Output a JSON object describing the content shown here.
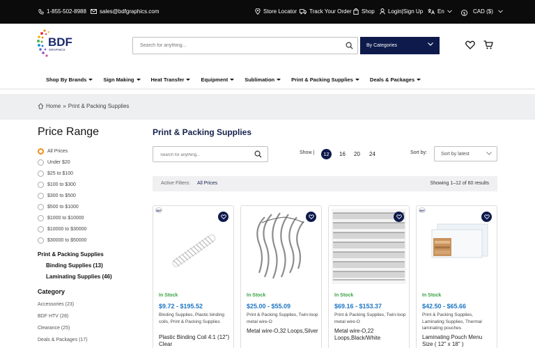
{
  "topbar": {
    "phone": "1-855-502-8988",
    "email": "sales@bdfgraphics.com",
    "store_locator": "Store Locator",
    "track_order": "Track Your Order",
    "shop": "Shop",
    "login": "Login|Sign Up",
    "language": "En",
    "currency": "CAD ($)"
  },
  "header": {
    "logo_text": "BDF",
    "logo_sub": "GRAPHICS",
    "search_placeholder": "Search for anything...",
    "category_button": "By Categories"
  },
  "nav": [
    "Shop By Brands",
    "Sign Making",
    "Heat Transfer",
    "Equipment",
    "Sublimation",
    "Print & Packing Supplies",
    "Deals & Packages"
  ],
  "breadcrumb": {
    "home": "Home",
    "sep": "»",
    "current": "Print & Packing Supplies"
  },
  "sidebar": {
    "price_title": "Price Range",
    "price_options": [
      "All Prices",
      "Under $20",
      "$25 to $100",
      "$100 to $300",
      "$300 to $500",
      "$500 to $1000",
      "$1000 to $10000",
      "$10000 to $30000",
      "$30000 to $50000"
    ],
    "selected_price": 0,
    "parent_category": "Print & Packing Supplies",
    "subcategories": [
      "Binding Supplies (13)",
      "Laminating Supplies (46)"
    ],
    "category_title": "Category",
    "categories": [
      "Accessories (23)",
      "BDF HTV (28)",
      "Clearance (25)",
      "Deals & Packages (17)"
    ]
  },
  "main": {
    "title": "Print & Packing Supplies",
    "search_placeholder": "Search for anything...",
    "show_label": "Show |",
    "show_options": [
      "12",
      "16",
      "20",
      "24"
    ],
    "show_selected": "12",
    "sort_label": "Sort by:",
    "sort_value": "Sort by latest",
    "active_filters_label": "Active Filters:",
    "active_filter": "All Prices",
    "results": "Showing 1–12 of 60 results"
  },
  "products": [
    {
      "badge": "BDF",
      "stock": "In Stock",
      "price": "$9.72 - $195.52",
      "categories": "Binding Supplies, Plastic binding coils, Print & Packing Supplies",
      "name": "Plastic Binding Coil 4:1 (12\") Clear",
      "image": "white-plastic-coil"
    },
    {
      "badge": "",
      "stock": "In Stock",
      "price": "$25.00 - $55.09",
      "categories": "Print & Packing Supplies, Twin-loop metal wire-O",
      "name": "Metal wire-O,32 Loops,Silver",
      "image": "silver-wire-o"
    },
    {
      "badge": "",
      "stock": "In Stock",
      "price": "$69.16 - $153.37",
      "categories": "Print & Packing Supplies, Twin-loop metal wire-O",
      "name": "Metal wire-O,22 Loops,Black/White",
      "image": "wire-o-rows"
    },
    {
      "badge": "BDF",
      "stock": "In Stock",
      "price": "$42.50 - $65.66",
      "categories": "Print & Packing Supplies, Laminating Supplies, Thermal laminating pouches",
      "name": "Laminating Pouch Menu Size ( 12\" x 18\" )",
      "image": "laminating-pouch"
    }
  ],
  "colors": {
    "navy": "#0d1a4b",
    "accent_orange": "#f28a17",
    "price_blue": "#1e76c4",
    "stock_green": "#3aa344"
  }
}
